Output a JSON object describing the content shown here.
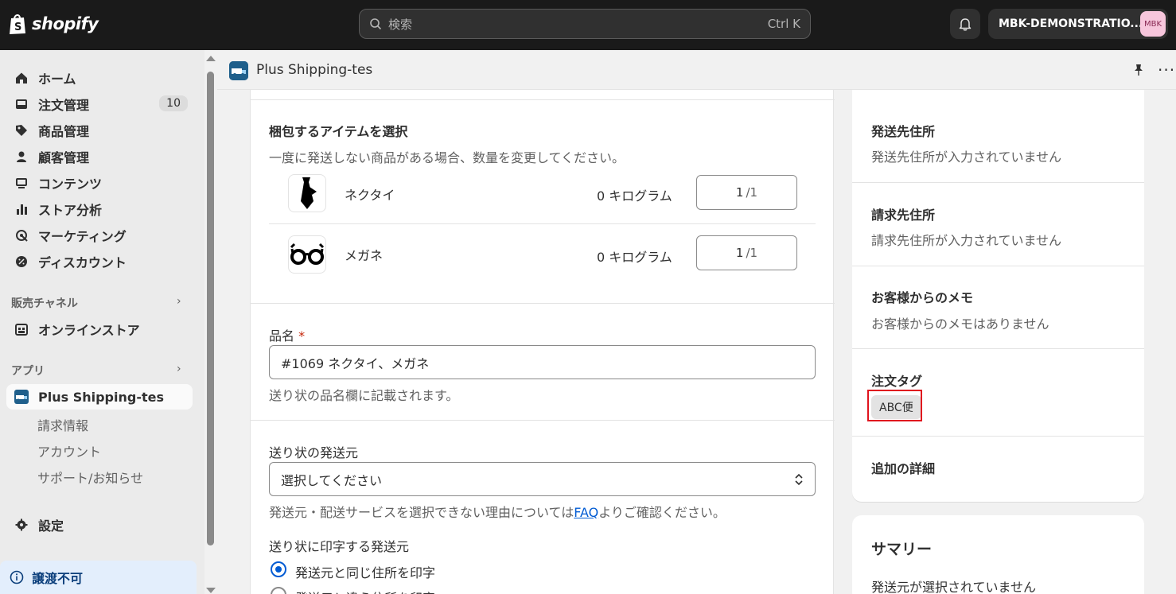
{
  "topbar": {
    "logo_text": "shopify",
    "search_placeholder": "検索",
    "search_shortcut": "Ctrl K",
    "store_name": "MBK-DEMONSTRATIO...",
    "store_avatar": "MBK"
  },
  "sidebar": {
    "items": [
      {
        "label": "ホーム",
        "icon": "home-icon"
      },
      {
        "label": "注文管理",
        "icon": "orders-icon",
        "badge": "10"
      },
      {
        "label": "商品管理",
        "icon": "tag-icon"
      },
      {
        "label": "顧客管理",
        "icon": "person-icon"
      },
      {
        "label": "コンテンツ",
        "icon": "content-icon"
      },
      {
        "label": "ストア分析",
        "icon": "analytics-icon"
      },
      {
        "label": "マーケティング",
        "icon": "marketing-icon"
      },
      {
        "label": "ディスカウント",
        "icon": "discount-icon"
      }
    ],
    "sales_channels_label": "販売チャネル",
    "online_store": "オンラインストア",
    "apps_label": "アプリ",
    "active_app": "Plus Shipping-tes",
    "app_subitems": [
      "請求情報",
      "アカウント",
      "サポート/お知らせ"
    ],
    "settings": "設定",
    "notice": "譲渡不可"
  },
  "app_header": {
    "title": "Plus Shipping-tes"
  },
  "main": {
    "pack_title": "梱包するアイテムを選択",
    "pack_desc": "一度に発送しない商品がある場合、数量を変更してください。",
    "items": [
      {
        "name": "ネクタイ",
        "weight": "0 キログラム",
        "qty": "1",
        "total": "/1",
        "icon": "necktie-icon"
      },
      {
        "name": "メガネ",
        "weight": "0 キログラム",
        "qty": "1",
        "total": "/1",
        "icon": "glasses-icon"
      }
    ],
    "product_name_label": "品名",
    "required_mark": "*",
    "product_name_value": "#1069 ネクタイ、メガネ",
    "product_name_help": "送り状の品名欄に記載されます。",
    "sender_label": "送り状の発送元",
    "sender_select": "選択してください",
    "sender_help_before": "発送元・配送サービスを選択できない理由については",
    "sender_help_link": "FAQ",
    "sender_help_after": "よりご確認ください。",
    "print_sender_label": "送り状に印字する発送元",
    "radio_same": "発送元と同じ住所を印字",
    "radio_other": "発送元と違う住所を印字"
  },
  "right": {
    "ship_addr_title": "発送先住所",
    "ship_addr_value": "発送先住所が入力されていません",
    "bill_addr_title": "請求先住所",
    "bill_addr_value": "請求先住所が入力されていません",
    "memo_title": "お客様からのメモ",
    "memo_value": "お客様からのメモはありません",
    "tags_title": "注文タグ",
    "tag_value": "ABC便",
    "details_title": "追加の詳細",
    "summary_title": "サマリー",
    "summary_value": "発送元が選択されていません"
  },
  "colors": {
    "topbar": "#1a1a1a",
    "accent": "#005bd3",
    "highlight": "#e0141e"
  }
}
